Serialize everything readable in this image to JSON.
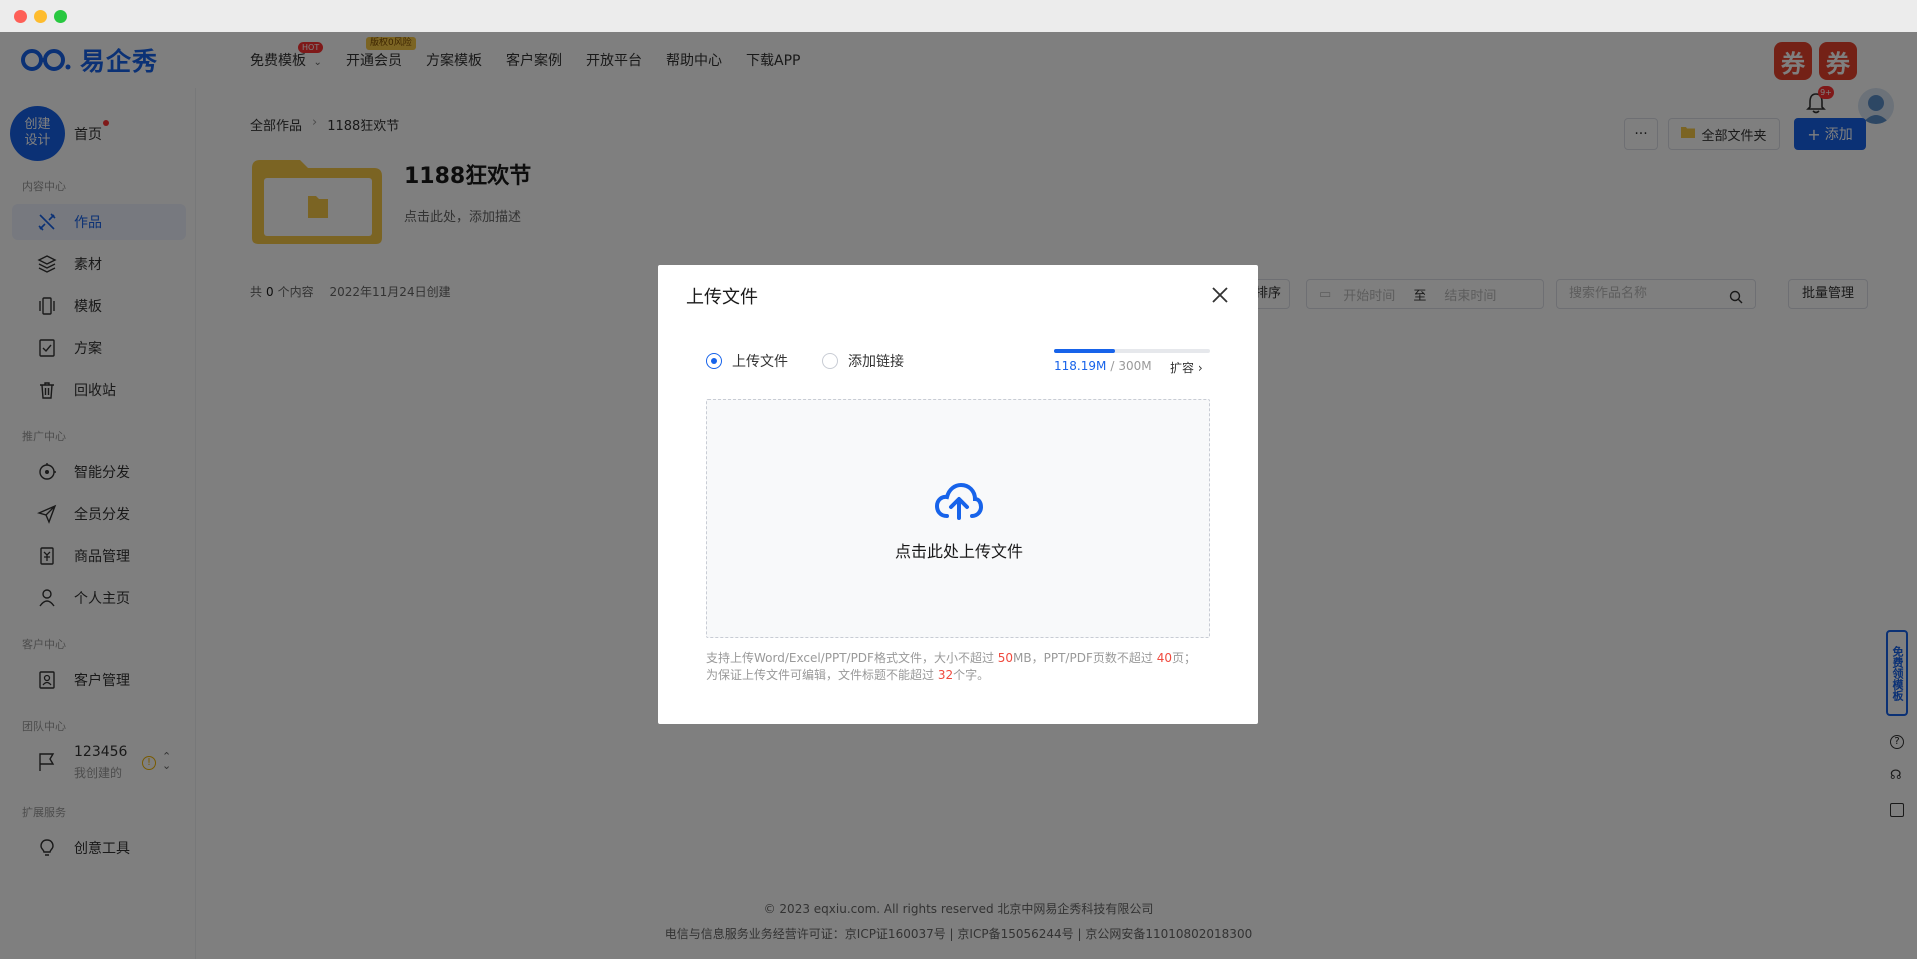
{
  "brand": {
    "name": "易企秀"
  },
  "topnav": {
    "items": [
      {
        "label": "免费模板",
        "badge": "HOT"
      },
      {
        "label": "开通会员",
        "badge": "版权0风险"
      },
      {
        "label": "方案模板"
      },
      {
        "label": "客户案例"
      },
      {
        "label": "开放平台"
      },
      {
        "label": "帮助中心"
      },
      {
        "label": "下载APP"
      }
    ],
    "coupons": [
      "券",
      "券"
    ],
    "notifications_badge": "9+"
  },
  "sidebar": {
    "create_label_1": "创建",
    "create_label_2": "设计",
    "home": "首页",
    "sections": {
      "content": "内容中心",
      "promotion": "推广中心",
      "customer": "客户中心",
      "team": "团队中心",
      "extension": "扩展服务"
    },
    "items": {
      "works": "作品",
      "materials": "素材",
      "templates": "模板",
      "plans": "方案",
      "recycle": "回收站",
      "smart_distribute": "智能分发",
      "staff_distribute": "全员分发",
      "product_manage": "商品管理",
      "profile": "个人主页",
      "customer_manage": "客户管理",
      "creative_tools": "创意工具"
    },
    "team": {
      "name": "123456",
      "sub": "我创建的"
    }
  },
  "main": {
    "breadcrumb": {
      "root": "全部作品",
      "current": "1188狂欢节"
    },
    "folder": {
      "title": "1188狂欢节",
      "description": "点击此处，添加描述"
    },
    "meta": {
      "prefix": "共",
      "count": "0",
      "suffix": "个内容",
      "created": "2022年11月24日创建"
    },
    "toolbar": {
      "more": "···",
      "all_folders": "全部文件夹",
      "add": "添加",
      "sort": "排序",
      "start_time": "开始时间",
      "to": "至",
      "end_time": "结束时间",
      "search_placeholder": "搜索作品名称",
      "batch": "批量管理"
    }
  },
  "floating": {
    "free_template": "免费领模板"
  },
  "footer": {
    "copyright": "© 2023 eqxiu.com. All rights reserved 北京中网易企秀科技有限公司",
    "license": "电信与信息服务业务经营许可证：京ICP证160037号 | 京ICP备15056244号 | 京公网安备11010802018300"
  },
  "modal": {
    "title": "上传文件",
    "tabs": {
      "upload": "上传文件",
      "link": "添加链接"
    },
    "selected_tab": "upload",
    "quota": {
      "used": "118.19M",
      "separator": "/",
      "total": "300M",
      "used_fraction": 0.39,
      "expand": "扩容"
    },
    "dropzone_text": "点击此处上传文件",
    "hint": {
      "l1_a": "支持上传Word/Excel/PPT/PDF格式文件，大小不超过 ",
      "l1_size": "50",
      "l1_b": "MB，PPT/PDF页数不超过 ",
      "l1_pages": "40",
      "l1_c": "页；",
      "l2_a": "为保证上传文件可编辑，文件标题不能超过 ",
      "l2_chars": "32",
      "l2_b": "个字。"
    }
  },
  "colors": {
    "accent": "#1763ea",
    "coupon": "#e8432d",
    "warning_red": "#f04a3e"
  }
}
